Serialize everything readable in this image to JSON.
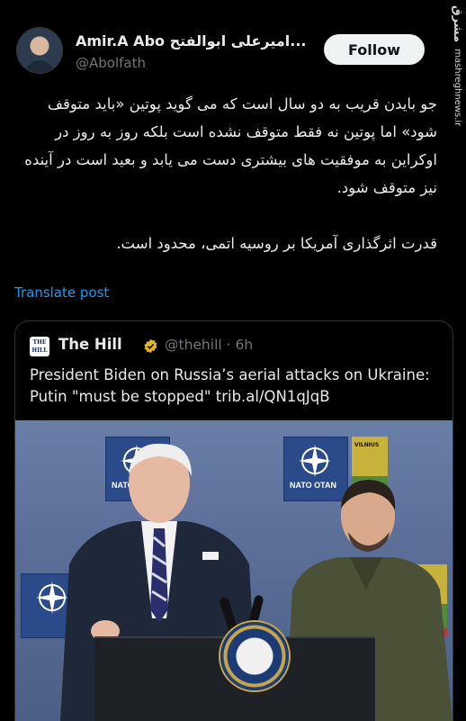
{
  "header": {
    "display_name": "Amir.A Abo امیرعلی ابوالفتح...",
    "handle": "@Abolfath",
    "follow_label": "Follow"
  },
  "watermark": {
    "logo": "مشرق",
    "site": "mashreghnews.ir"
  },
  "tweet": {
    "paragraph1": "جو بایدن قریب به دو سال است که می گوید پوتین «باید متوقف شود» اما پوتین نه فقط متوقف نشده است بلکه روز به روز در اوکراین به موفقیت های بیشتری دست می یابد و بعید است در آینده نیز متوقف شود.",
    "paragraph2": "قدرت اثرگذاری آمریکا بر روسیه اتمی، محدود است.",
    "translate_label": "Translate post"
  },
  "quote": {
    "logo_text": "THE HILL",
    "name": "The Hill",
    "meta": "@thehill · 6h",
    "text": "President Biden on Russia’s aerial attacks on Ukraine: Putin \"must be stopped\" trib.al/QN1qJqB",
    "image": {
      "sign_text_left": "NATO OTAN",
      "sign_text_right": "NATO OTAN",
      "banner_text": "VILNIUS"
    }
  },
  "colors": {
    "background": "#000000",
    "link": "#1d9bf0",
    "muted": "#71767b",
    "verified_gold": "#e2b719"
  }
}
